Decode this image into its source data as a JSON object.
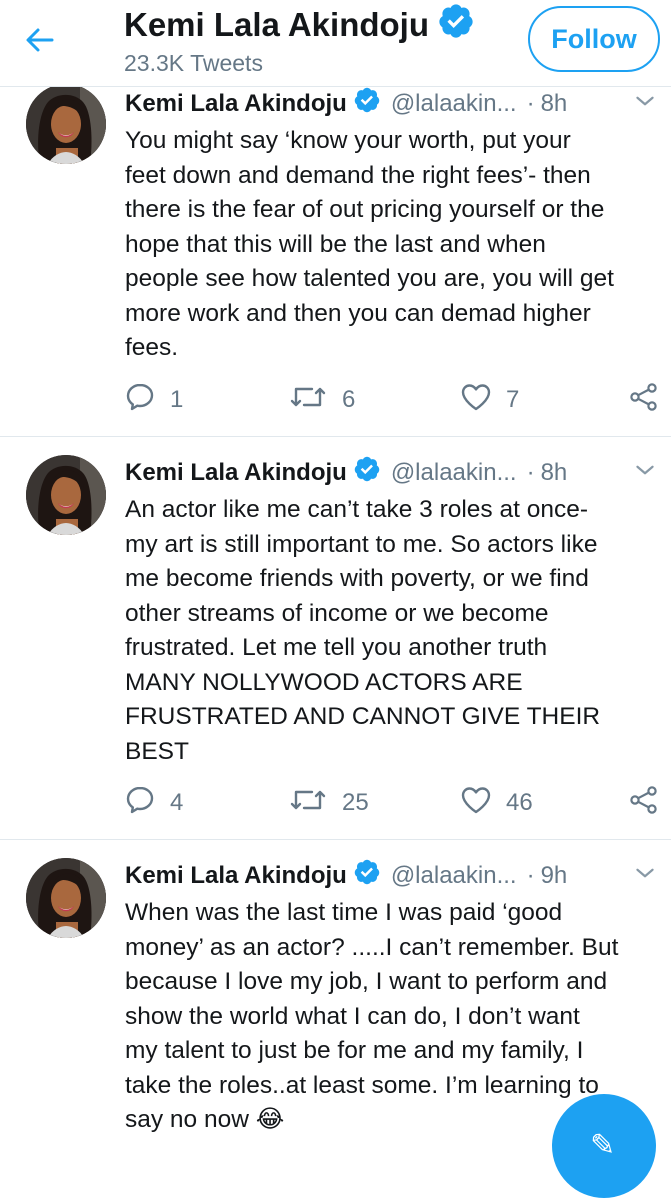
{
  "header": {
    "title": "Kemi Lala Akindoju",
    "tweet_count": "23.3K Tweets",
    "follow_label": "Follow"
  },
  "colors": {
    "accent": "#1da1f2",
    "text": "#14171a",
    "secondary": "#657786",
    "divider": "#e1e8ed"
  },
  "tweets": [
    {
      "name": "Kemi Lala Akindoju",
      "handle": "@lalaakin...",
      "time": "8h",
      "lines": [
        "You might say ‘know your worth, put your",
        "feet down and demand the right fees’- then",
        "there is the fear of out pricing yourself or the",
        "hope that this will be the last and when",
        "people see how talented you are, you will get",
        "more work and then you can demad higher",
        "fees."
      ],
      "replies": "1",
      "retweets": "6",
      "likes": "7"
    },
    {
      "name": "Kemi Lala Akindoju",
      "handle": "@lalaakin...",
      "time": "8h",
      "lines": [
        "An actor like me can’t take 3 roles at once-",
        "my art is still important to me. So actors like",
        "me become friends with poverty, or we find",
        "other streams of income or we become",
        "frustrated. Let me tell you another truth",
        "MANY NOLLYWOOD ACTORS ARE",
        "FRUSTRATED AND CANNOT GIVE THEIR",
        "BEST"
      ],
      "replies": "4",
      "retweets": "25",
      "likes": "46"
    },
    {
      "name": "Kemi Lala Akindoju",
      "handle": "@lalaakin...",
      "time": "9h",
      "lines": [
        "When was the last time I was paid ‘good",
        "money’ as an actor? .....I can’t remember. But",
        "because I love my job, I want to perform and",
        "show the world what I can do, I don’t want",
        "my talent to just be for me and my family, I",
        "take the roles..at least some. I’m learning to",
        "say no now 😂"
      ]
    }
  ],
  "separator": "·",
  "icons": {
    "back": "arrow-left-icon",
    "verified": "verified-badge-icon",
    "caret": "chevron-down-icon",
    "reply": "reply-icon",
    "retweet": "retweet-icon",
    "like": "heart-icon",
    "share": "share-icon",
    "compose": "compose-icon"
  }
}
